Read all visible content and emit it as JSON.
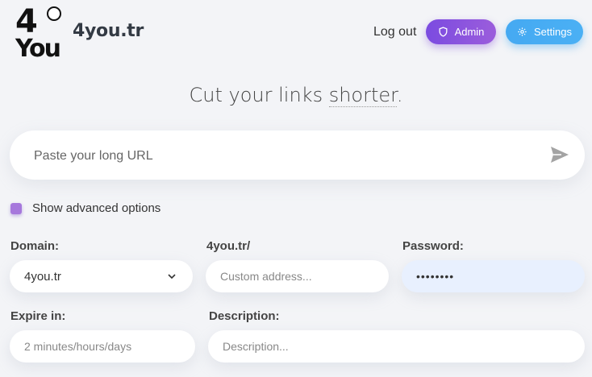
{
  "header": {
    "brand": "4you.tr",
    "logout_label": "Log out",
    "admin_label": "Admin",
    "settings_label": "Settings"
  },
  "headline": {
    "prefix": "Cut your links ",
    "accent": "shorter",
    "suffix": "."
  },
  "url_input": {
    "placeholder": "Paste your long URL"
  },
  "advanced": {
    "label": "Show advanced options",
    "checked": true
  },
  "form": {
    "domain_label": "Domain:",
    "domain_value": "4you.tr",
    "custom_label": "4you.tr/",
    "custom_placeholder": "Custom address...",
    "password_label": "Password:",
    "password_value": "••••••••",
    "expire_label": "Expire in:",
    "expire_placeholder": "2 minutes/hours/days",
    "description_label": "Description:",
    "description_placeholder": "Description..."
  },
  "icons": {
    "admin": "shield-icon",
    "settings": "gear-icon",
    "send": "send-icon",
    "domain": "chevron-down-icon"
  },
  "colors": {
    "admin": "#8b55de",
    "settings": "#47adf3",
    "checkbox": "#a678dc"
  }
}
